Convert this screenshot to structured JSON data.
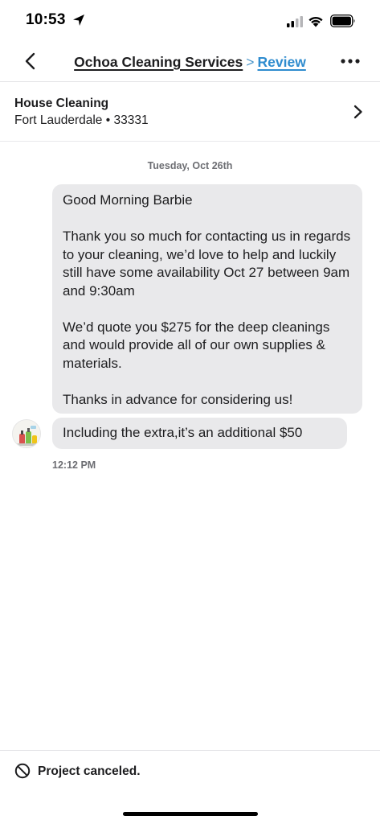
{
  "status_bar": {
    "time": "10:53"
  },
  "nav": {
    "business_name": "Ochoa Cleaning Services",
    "separator": ">",
    "review_label": "Review"
  },
  "project": {
    "service": "House Cleaning",
    "location": "Fort Lauderdale • 33331"
  },
  "conversation": {
    "date": "Tuesday, Oct 26th",
    "messages": [
      {
        "text": "Good Morning Barbie\n\nThank you so much for contacting us in regards to your cleaning, we’d love to help and luckily still have some availability Oct 27 between 9am and 9:30am\n\nWe’d quote you $275 for the deep cleanings and would provide all of our own supplies & materials.\n\nThanks in advance for considering us!"
      },
      {
        "text": "Including the extra,it’s an additional $50"
      }
    ],
    "timestamp": "12:12 PM"
  },
  "footer": {
    "status": "Project canceled."
  },
  "icons": {
    "back": "chevron-left-icon",
    "more": "more-dots-icon",
    "project_chevron": "chevron-right-icon",
    "status": "cancel-circle-icon"
  },
  "colors": {
    "link": "#2f8ccf",
    "bubble": "#e9e9eb",
    "muted_text": "#6d6e73"
  }
}
